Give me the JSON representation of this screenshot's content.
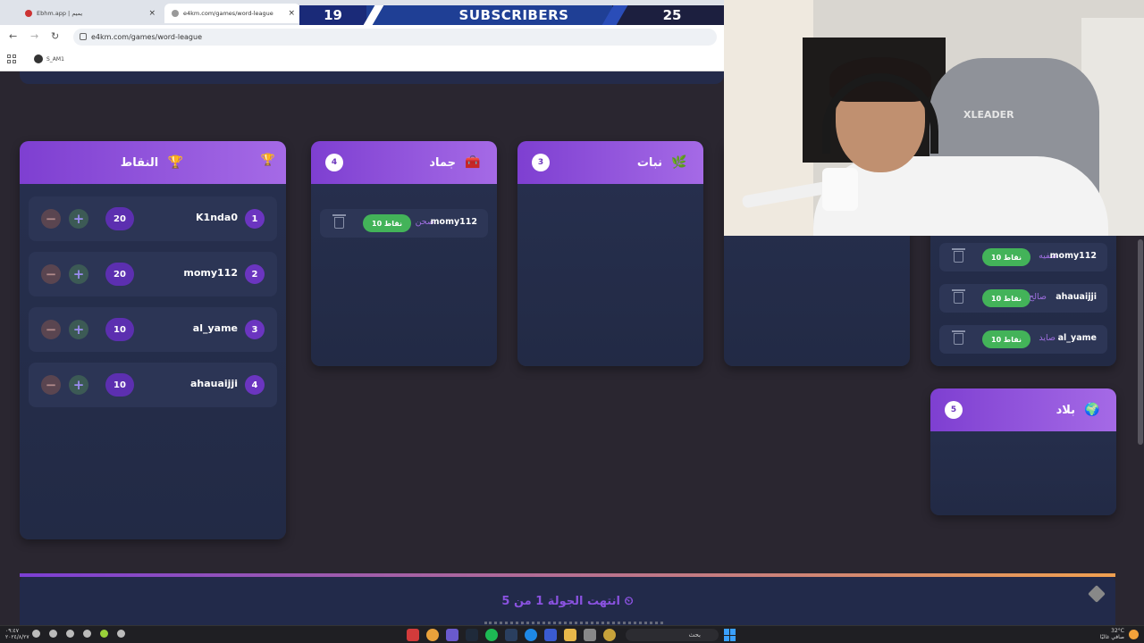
{
  "browser": {
    "tabs": [
      {
        "label": "Ebhm.app | يميم",
        "active": false
      },
      {
        "label": "e4km.com/games/word-league",
        "active": true
      }
    ],
    "address": "e4km.com/games/word-league",
    "bookmark": "S_AM1"
  },
  "subscribers": {
    "left_count": "19",
    "title": "SUBSCRIBERS",
    "right_count": "25"
  },
  "scores": {
    "title": "النقاط",
    "rows": [
      {
        "rank": "1",
        "name": "K1nda0",
        "points": "20"
      },
      {
        "rank": "2",
        "name": "momy112",
        "points": "20"
      },
      {
        "rank": "3",
        "name": "al_yame",
        "points": "10"
      },
      {
        "rank": "4",
        "name": "ahauaijji",
        "points": "10"
      }
    ]
  },
  "categories": {
    "jamad": {
      "title": "جماد",
      "count": "4",
      "entries": [
        {
          "player": "momy112",
          "word": "صحن",
          "points": "10 نقاط"
        }
      ]
    },
    "nabat": {
      "title": "نبات",
      "count": "3",
      "entries": []
    },
    "people": {
      "entries": [
        {
          "player": "momy112",
          "word": "صفيه",
          "points": "10 نقاط"
        },
        {
          "player": "ahauaijji",
          "word": "صالح",
          "points": "10 نقاط"
        },
        {
          "player": "al_yame",
          "word": "صايد",
          "points": "10 نقاط"
        }
      ]
    },
    "bilad": {
      "title": "بلاد",
      "count": "5",
      "entries": []
    }
  },
  "round": {
    "text": "انتهت الجولة 1 من 5"
  },
  "cam": {
    "chair_logo": "XLEADER"
  },
  "taskbar": {
    "search": "بحث",
    "time": "٠٩:٤٧",
    "date": "٢٠٢٤/٨/٢٧",
    "weather_temp": "32°C",
    "weather_desc": "صافي غالبًا"
  },
  "colors": {
    "accent_purple": "#7e3fd1",
    "pill_green": "#43b359",
    "card_bg": "#27304f",
    "page_bg": "#2a2630"
  }
}
